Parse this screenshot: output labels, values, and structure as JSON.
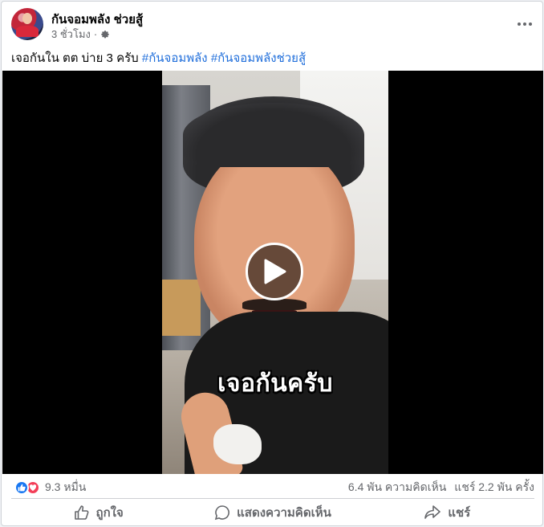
{
  "post": {
    "page_name": "กันจอมพลัง ช่วยสู้",
    "time": "3 ชั่วโมง",
    "separator": "·",
    "audience_icon": "gear-icon"
  },
  "caption": {
    "text": "เจอกันใน ตต บ่าย 3 ครับ ",
    "hashtags": [
      "#กันจอมพลัง",
      "#กันจอมพลังช่วยสู้"
    ]
  },
  "video": {
    "overlay_text": "เจอกันครับ",
    "play_icon": "play-icon"
  },
  "stats": {
    "reaction_icons": [
      "like-icon",
      "love-icon"
    ],
    "reactions_count": "9.3 หมื่น",
    "comments": "6.4 พัน ความคิดเห็น",
    "shares": "แชร์ 2.2 พัน ครั้ง"
  },
  "actions": {
    "like": "ถูกใจ",
    "comment": "แสดงความคิดเห็น",
    "share": "แชร์"
  },
  "colors": {
    "link": "#216fdb",
    "like": "#1877f2",
    "love": "#f33e58",
    "muted": "#65676b"
  }
}
